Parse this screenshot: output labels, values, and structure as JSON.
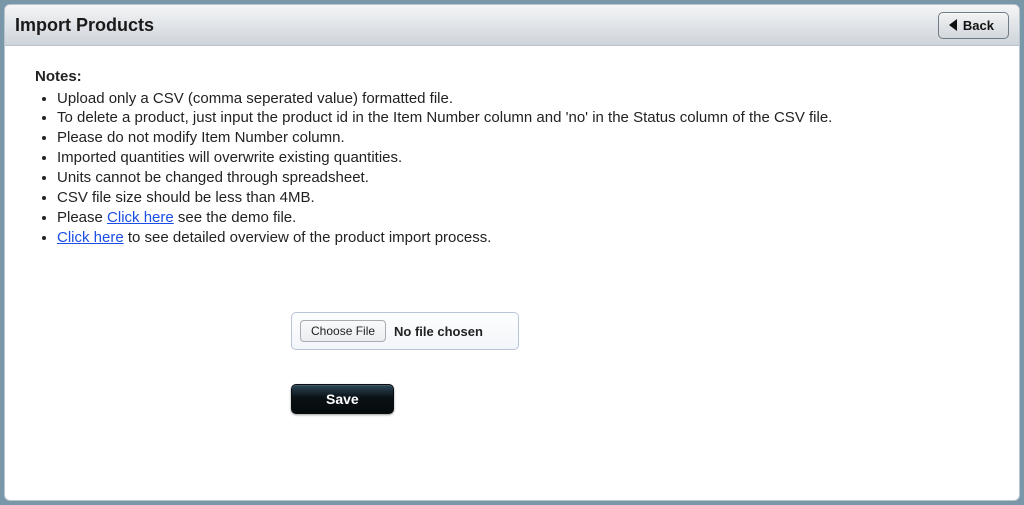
{
  "header": {
    "title": "Import Products",
    "back_label": "Back"
  },
  "notes": {
    "heading": "Notes:",
    "items": [
      {
        "prefix": "Upload only a CSV (comma seperated value) formatted file."
      },
      {
        "prefix": "To delete a product, just input the product id in the Item Number column and 'no' in the Status column of the CSV file."
      },
      {
        "prefix": "Please do not modify Item Number column."
      },
      {
        "prefix": "Imported quantities will overwrite existing quantities."
      },
      {
        "prefix": "Units cannot be changed through spreadsheet."
      },
      {
        "prefix": "CSV file size should be less than 4MB."
      },
      {
        "prefix": "Please ",
        "link": "Click here",
        "suffix": " see the demo file."
      },
      {
        "link": "Click here",
        "suffix": " to see detailed overview of the product import process."
      }
    ]
  },
  "file_picker": {
    "button_label": "Choose File",
    "status": "No file chosen"
  },
  "actions": {
    "save_label": "Save"
  }
}
